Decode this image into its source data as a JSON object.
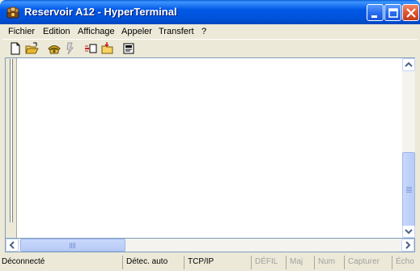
{
  "window": {
    "title": "Reservoir A12 - HyperTerminal",
    "accent_color": "#0055e5",
    "close_color": "#e0542e"
  },
  "menu": {
    "items": [
      {
        "label": "Fichier"
      },
      {
        "label": "Edition"
      },
      {
        "label": "Affichage"
      },
      {
        "label": "Appeler"
      },
      {
        "label": "Transfert"
      },
      {
        "label": "?"
      }
    ]
  },
  "toolbar": {
    "buttons": [
      {
        "icon": "new-document-icon"
      },
      {
        "icon": "open-folder-icon"
      },
      {
        "icon": "call-icon"
      },
      {
        "icon": "disconnect-icon"
      },
      {
        "icon": "send-icon"
      },
      {
        "icon": "receive-icon"
      },
      {
        "icon": "properties-icon"
      }
    ]
  },
  "status": {
    "connection": "Déconnecté",
    "detection": "Détec. auto",
    "protocol": "TCP/IP",
    "scroll": "DÉFIL",
    "caps": "Maj",
    "num": "Num",
    "capture": "Capturer",
    "echo": "Écho"
  }
}
